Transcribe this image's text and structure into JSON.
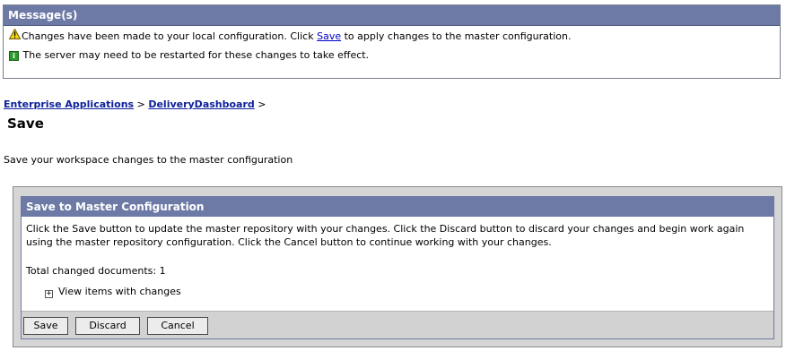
{
  "messages": {
    "title": "Message(s)",
    "warning": {
      "icon": "warning-triangle-icon",
      "text_before": "Changes have been made to your local configuration. Click ",
      "link": "Save",
      "text_after": " to apply changes to the master configuration."
    },
    "info": {
      "icon": "info-icon",
      "text": "The server may need to be restarted for these changes to take effect."
    }
  },
  "breadcrumb": {
    "items": [
      "Enterprise Applications",
      "DeliveryDashboard"
    ],
    "separator": ">"
  },
  "page": {
    "title": "Save",
    "description": "Save your workspace changes to the master configuration"
  },
  "panel": {
    "title": "Save to Master Configuration",
    "instructions": "Click the Save button to update the master repository with your changes. Click the Discard button to discard your changes and begin work again using the master repository configuration. Click the Cancel button to continue working with your changes.",
    "total_label": "Total changed documents: 1",
    "view_label": "View items with changes",
    "buttons": {
      "save": "Save",
      "discard": "Discard",
      "cancel": "Cancel"
    }
  },
  "colors": {
    "header_bg": "#6d7aa6",
    "link": "#0b1f9a",
    "button_bar": "#d2d2d2"
  }
}
